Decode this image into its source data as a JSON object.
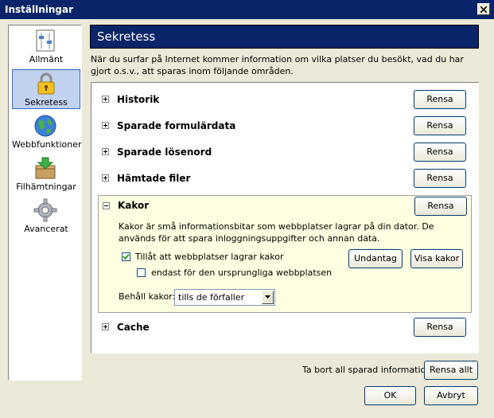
{
  "window": {
    "title": "Inställningar"
  },
  "sidebar": {
    "items": [
      {
        "label": "Allmänt",
        "icon": "general-settings-icon"
      },
      {
        "label": "Sekretess",
        "icon": "lock-icon",
        "selected": true
      },
      {
        "label": "Webbfunktioner",
        "icon": "globe-icon"
      },
      {
        "label": "Filhämtningar",
        "icon": "download-box-icon"
      },
      {
        "label": "Avancerat",
        "icon": "gear-icon"
      }
    ]
  },
  "header": {
    "title": "Sekretess"
  },
  "intro": "När du surfar på Internet kommer information om vilka platser du besökt, vad du har gjort o.s.v., att sparas inom följande områden.",
  "sections": [
    {
      "label": "Historik",
      "button": "Rensa"
    },
    {
      "label": "Sparade formulärdata",
      "button": "Rensa"
    },
    {
      "label": "Sparade lösenord",
      "button": "Rensa"
    },
    {
      "label": "Hämtade filer",
      "button": "Rensa"
    },
    {
      "label": "Kakor",
      "button": "Rensa"
    },
    {
      "label": "Cache",
      "button": "Rensa"
    }
  ],
  "kakor": {
    "description": "Kakor är små informationsbitar som webbplatser lagrar på din dator. De används för att spara inloggningsuppgifter och annan data.",
    "allow_label": "Tillåt att webbplatser lagrar kakor",
    "allow_checked": true,
    "origin_only_label": "endast för den ursprungliga webbplatsen",
    "origin_only_checked": false,
    "exceptions_button": "Undantag",
    "show_cookies_button": "Visa kakor",
    "keep_label": "Behåll kakor:",
    "keep_value": "tills de förfaller"
  },
  "footer": {
    "clear_all_label": "Ta bort all sparad information:",
    "clear_all_button": "Rensa allt",
    "ok_button": "OK",
    "cancel_button": "Avbryt"
  },
  "colors": {
    "title_bar": "#0a246a",
    "selected_item": "#c1d2ee",
    "kakor_background": "#ffffe1"
  }
}
